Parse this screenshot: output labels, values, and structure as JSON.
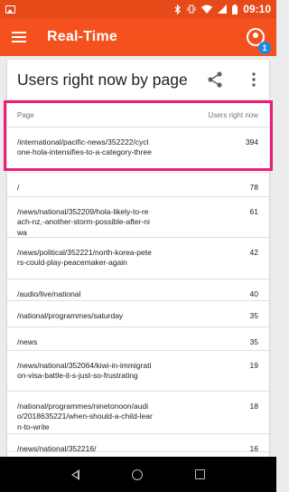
{
  "status_bar": {
    "time": "09:10",
    "icons": [
      "image-icon",
      "bluetooth-icon",
      "vibrate-icon",
      "wifi-icon",
      "signal-icon",
      "battery-icon"
    ]
  },
  "app_bar": {
    "title": "Real-Time",
    "account_badge": "1",
    "color": "#f4511e"
  },
  "card": {
    "title": "Users right now by page",
    "columns": {
      "page": "Page",
      "users": "Users right now"
    },
    "rows": [
      {
        "page": "/international/pacific-news/352222/cyclone-hola-intensifies-to-a-category-three",
        "users": "394"
      },
      {
        "page": "/",
        "users": "78"
      },
      {
        "page": "/news/national/352209/hola-likely-to-reach-nz,-another-storm-possible-after-niwa",
        "users": "61"
      },
      {
        "page": "/news/political/352221/north-korea-peters-could-play-peacemaker-again",
        "users": "42"
      },
      {
        "page": "/audio/live/national",
        "users": "40"
      },
      {
        "page": "/national/programmes/saturday",
        "users": "35"
      },
      {
        "page": "/news",
        "users": "35"
      },
      {
        "page": "/news/national/352064/kiwi-in-immigration-visa-battle-it-s-just-so-frustrating",
        "users": "19"
      },
      {
        "page": "/national/programmes/ninetonoon/audio/2018635221/when-should-a-child-learn-to-write",
        "users": "18"
      },
      {
        "page": "/news/national/352216/",
        "users": "16"
      }
    ]
  },
  "highlight_color": "#e91e7b"
}
